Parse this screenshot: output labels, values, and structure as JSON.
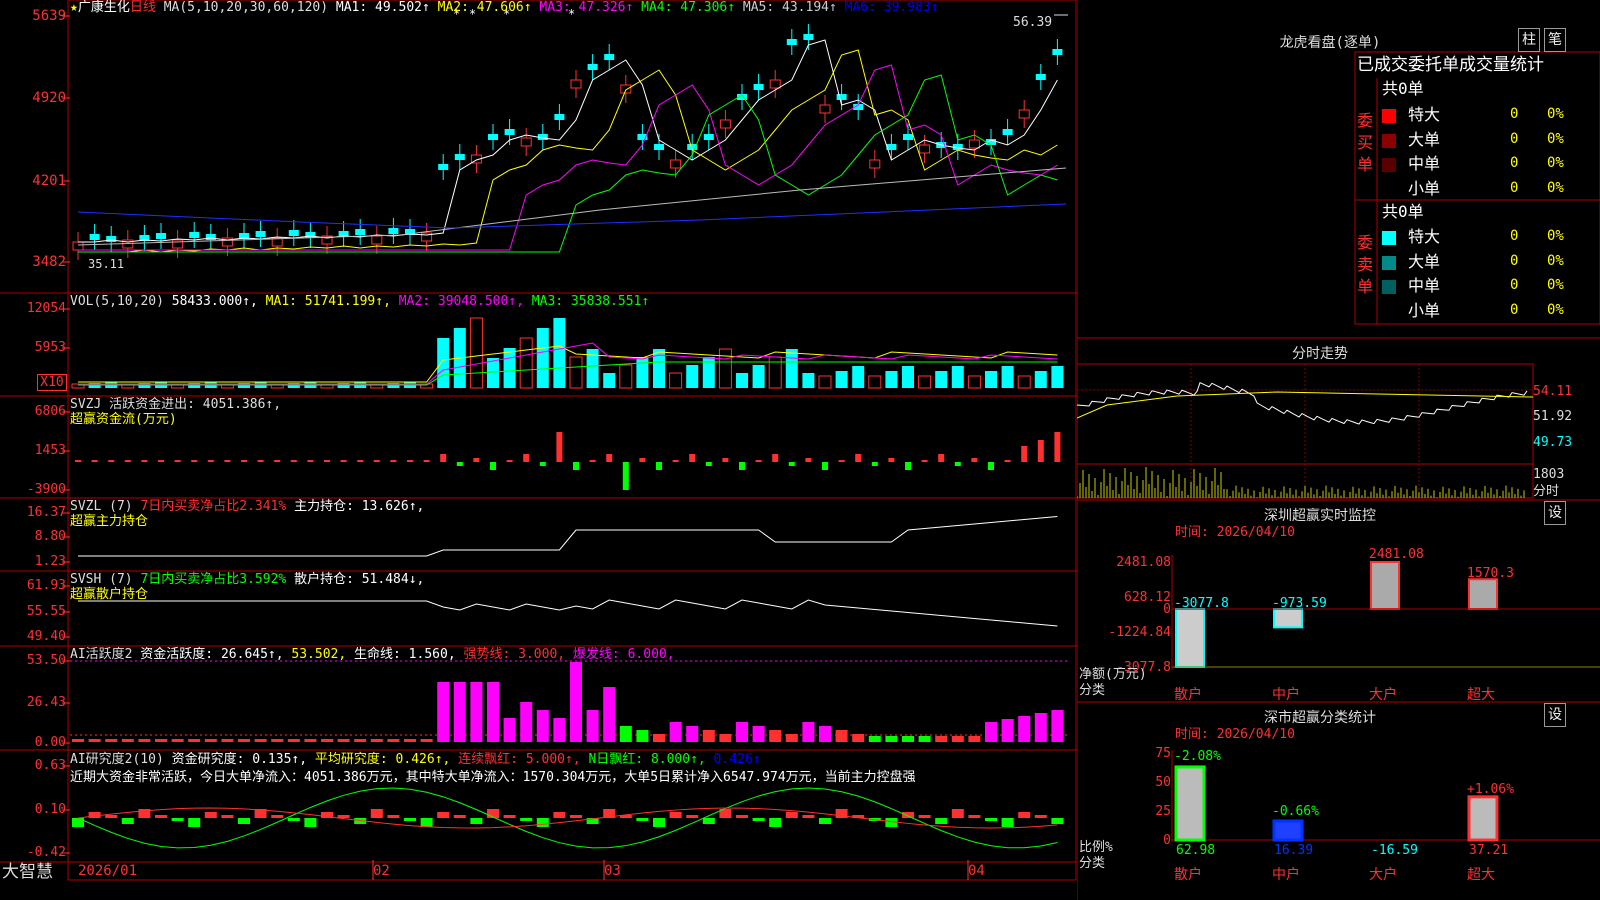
{
  "header": {
    "star": "★",
    "stock_name": "广康生化",
    "period": "日线",
    "ma_items": [
      {
        "label": "MA(5,10,20,30,60,120)",
        "value": "",
        "color": "#dddddd"
      },
      {
        "label": "MA1:",
        "value": "49.502↑",
        "color": "#ffffff"
      },
      {
        "label": "MA2:",
        "value": "47.606↑",
        "color": "#ffff00"
      },
      {
        "label": "MA3:",
        "value": "47.326↑",
        "color": "#ff00ff"
      },
      {
        "label": "MA4:",
        "value": "47.306↑",
        "color": "#00ff00"
      },
      {
        "label": "MA5:",
        "value": "43.194↑",
        "color": "#cccccc"
      },
      {
        "label": "MA6:",
        "value": "39.983↑",
        "color": "#0000ff"
      }
    ],
    "high_marker": "56.39",
    "low_marker": "35.11"
  },
  "axes": {
    "price": [
      "5639",
      "4920",
      "4201",
      "3482"
    ],
    "vol": [
      "12054",
      "5953",
      "X10"
    ],
    "svzj": [
      "6806",
      "1453",
      "-3900"
    ],
    "svzl": [
      "16.37",
      "8.80",
      "1.23"
    ],
    "svsh": [
      "61.93",
      "55.55",
      "49.40"
    ],
    "ai1": [
      "53.50",
      "26.43",
      "0.00"
    ],
    "ai2": [
      "0.63",
      "0.10",
      "-0.42"
    ],
    "dates": [
      "2026/01",
      "02",
      "03",
      "04"
    ]
  },
  "indicators": {
    "vol": [
      {
        "text": "VOL(5,10,20)",
        "color": "#dddddd"
      },
      {
        "text": "58433.000↑,",
        "color": "#ffffff"
      },
      {
        "text": "MA1: 51741.199↑,",
        "color": "#ffff00"
      },
      {
        "text": "MA2: 39048.500↑,",
        "color": "#ff00ff"
      },
      {
        "text": "MA3: 35838.551↑",
        "color": "#00ff00"
      }
    ],
    "svzj": [
      {
        "text": "SVZJ  活跃资金进出: 4051.386↑,",
        "color": "#dddddd"
      }
    ],
    "svzj_sub": "超赢资金流(万元)",
    "svzl": [
      {
        "text": "SVZL  (7)",
        "color": "#dddddd"
      },
      {
        "text": "7日内买卖净占比2.341%",
        "color": "#ff3030"
      },
      {
        "text": "主力持仓: 13.626↑,",
        "color": "#ffffff"
      }
    ],
    "svzl_sub": "超赢主力持仓",
    "svsh": [
      {
        "text": "SVSH  (7)",
        "color": "#dddddd"
      },
      {
        "text": "7日内买卖净占比3.592%",
        "color": "#00ff00"
      },
      {
        "text": "散户持仓: 51.484↓,",
        "color": "#ffffff"
      }
    ],
    "svsh_sub": "超赢散户持仓",
    "ai1": [
      {
        "text": "AI活跃度2",
        "color": "#dddddd"
      },
      {
        "text": "资金活跃度: 26.645↑,",
        "color": "#ffffff"
      },
      {
        "text": "53.502,",
        "color": "#ffff00"
      },
      {
        "text": "生命线: 1.560,",
        "color": "#ffffff"
      },
      {
        "text": "强势线: 3.000,",
        "color": "#ff3030"
      },
      {
        "text": "爆发线: 6.000,",
        "color": "#ff00ff"
      }
    ],
    "ai2": [
      {
        "text": "AI研究度2(10)",
        "color": "#dddddd"
      },
      {
        "text": "资金研究度: 0.135↑,",
        "color": "#ffffff"
      },
      {
        "text": "平均研究度: 0.426↑,",
        "color": "#ffff00"
      },
      {
        "text": "连续飘红: 5.000↑,",
        "color": "#ff3030"
      },
      {
        "text": "N日飘红: 8.000↑,",
        "color": "#00ff00"
      },
      {
        "text": "0.426↑",
        "color": "#0000ff"
      }
    ],
    "ai2_summary": "近期大资金非常活跃，今日大单净流入：4051.386万元，其中特大单净流入：1570.304万元，大单5日累计净入6547.974万元，当前主力控盘强"
  },
  "footer": {
    "brand": "大智慧"
  },
  "dragon": {
    "title": "龙虎看盘(逐单)",
    "btn_bar": "柱",
    "btn_pen": "笔",
    "subtitle": "已成交委托单成交量统计",
    "buy_label": "委买单",
    "sell_label": "委卖单",
    "buy_total": "共0单",
    "sell_total": "共0单",
    "buy_rows": [
      {
        "name": "特大",
        "count": "0",
        "pct": "0%",
        "color": "#ff0000"
      },
      {
        "name": "大单",
        "count": "0",
        "pct": "0%",
        "color": "#8b0000"
      },
      {
        "name": "中单",
        "count": "0",
        "pct": "0%",
        "color": "#5a0000"
      },
      {
        "name": "小单",
        "count": "0",
        "pct": "0%",
        "color": ""
      }
    ],
    "sell_rows": [
      {
        "name": "特大",
        "count": "0",
        "pct": "0%",
        "color": "#00ffff"
      },
      {
        "name": "大单",
        "count": "0",
        "pct": "0%",
        "color": "#008b8b"
      },
      {
        "name": "中单",
        "count": "0",
        "pct": "0%",
        "color": "#006060"
      },
      {
        "name": "小单",
        "count": "0",
        "pct": "0%",
        "color": ""
      }
    ]
  },
  "intraday": {
    "title": "分时走势",
    "labels": [
      "54.11",
      "51.92",
      "49.73"
    ],
    "vol_label": "1803",
    "bottom_label": "分时"
  },
  "realtime": {
    "title": "深圳超赢实时监控",
    "btn": "设",
    "time": "时间: 2026/04/10",
    "axis": [
      "2481.08",
      "628.12",
      "0",
      "-1224.84",
      "-3077.8"
    ],
    "ylabel": "净额(万元)",
    "xlabel": "分类",
    "categories": [
      "散户",
      "中户",
      "大户",
      "超大"
    ],
    "values": [
      -3077.8,
      -973.59,
      2481.08,
      1570.3
    ],
    "value_labels": [
      "-3077.8",
      "-973.59",
      "2481.08",
      "1570.3"
    ]
  },
  "classify": {
    "title": "深市超赢分类统计",
    "btn": "设",
    "time": "时间: 2026/04/10",
    "axis": [
      "75",
      "50",
      "25",
      "0"
    ],
    "ylabel": "比例%",
    "xlabel": "分类",
    "categories": [
      "散户",
      "中户",
      "大户",
      "超大"
    ],
    "bar_values": [
      62.98,
      16.39,
      0,
      37.21
    ],
    "top_labels": [
      "-2.08%",
      "-0.66%",
      "",
      "+1.06%"
    ],
    "bottom_labels": [
      "62.98",
      "16.39",
      "-16.59",
      "37.21"
    ]
  }
}
